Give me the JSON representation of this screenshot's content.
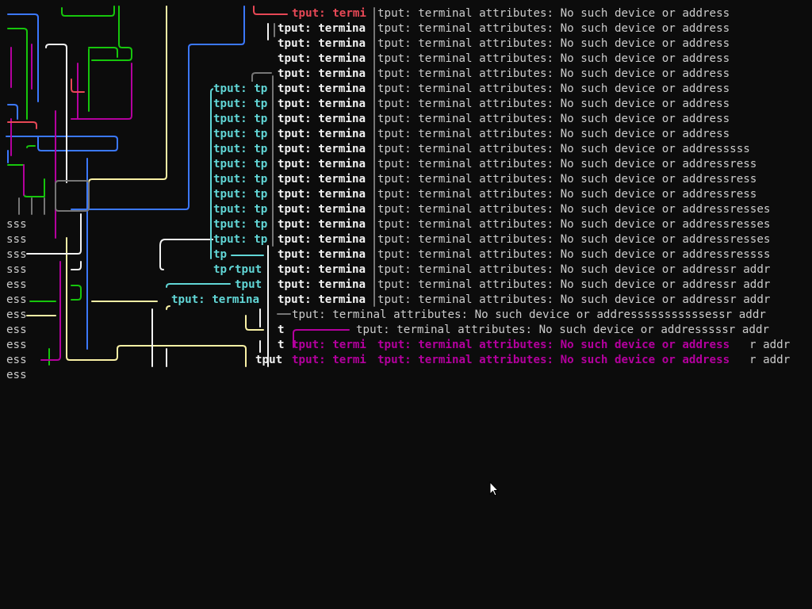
{
  "terminal": {
    "full_error": "tput: terminal attributes: No such device or address",
    "short_error": "tput: termina",
    "cut_error": "tput: termi",
    "tp_error": "tput: tp",
    "tput": "tput",
    "tp": "tp",
    "t": "t",
    "tput_termina_right": "tput: termina",
    "rows": [
      "tput: terminal attributes: No such device or address",
      "tput: terminal attributes: No such device or address",
      "tput: terminal attributes: No such device or address",
      "tput: terminal attributes: No such device or address",
      "tput: terminal attributes: No such device or address",
      "tput: terminal attributes: No such device or address",
      "tput: terminal attributes: No such device or address",
      "tput: terminal attributes: No such device or address",
      "tput: terminal attributes: No such device or address",
      "tput: terminal attributes: No such device or addresssss",
      "tput: terminal attributes: No such device or addressress",
      "tput: terminal attributes: No such device or addressress",
      "tput: terminal attributes: No such device or addressress",
      "tput: terminal attributes: No such device or addressresses",
      "tput: terminal attributes: No such device or addressresses",
      "tput: terminal attributes: No such device or addressresses",
      "tput: terminal attributes: No such device or addressressss",
      "tput: terminal attributes: No such device or addressr addr",
      "tput: terminal attributes: No such device or addressr addr",
      "tput: terminal attributes: No such device or addressr addr"
    ],
    "row_wide": "tput: terminal attributes: No such device or addresssssssssssessr addr",
    "row_offset": "tput: terminal attributes: No such device or addresssssr addr",
    "magenta_row": "tput: terminal attributes: No such device or address",
    "suffix_r_addr": "r addr",
    "left_fragments": [
      "sss",
      "sss",
      "sss",
      "sss",
      "ess",
      "ess",
      "ess",
      "ess",
      "ess",
      "ess",
      "ess"
    ]
  },
  "colors": {
    "background": "#0c0c0c",
    "gray_text": "#cccccc",
    "white_text": "#f2f2f2",
    "cyan_text": "#61d6d6",
    "red_text": "#e74856",
    "magenta_text": "#b4009e",
    "dim_text": "#767676",
    "pipe_blue": "#3b78ff",
    "pipe_green": "#16c60c",
    "pipe_magenta": "#b4009e",
    "pipe_yellow": "#f9f1a5",
    "pipe_white": "#f2f2f2",
    "pipe_red": "#e74856",
    "pipe_cyan": "#61d6d6",
    "pipe_gray": "#767676"
  },
  "pointer": {
    "icon": "mouse-pointer-icon"
  }
}
